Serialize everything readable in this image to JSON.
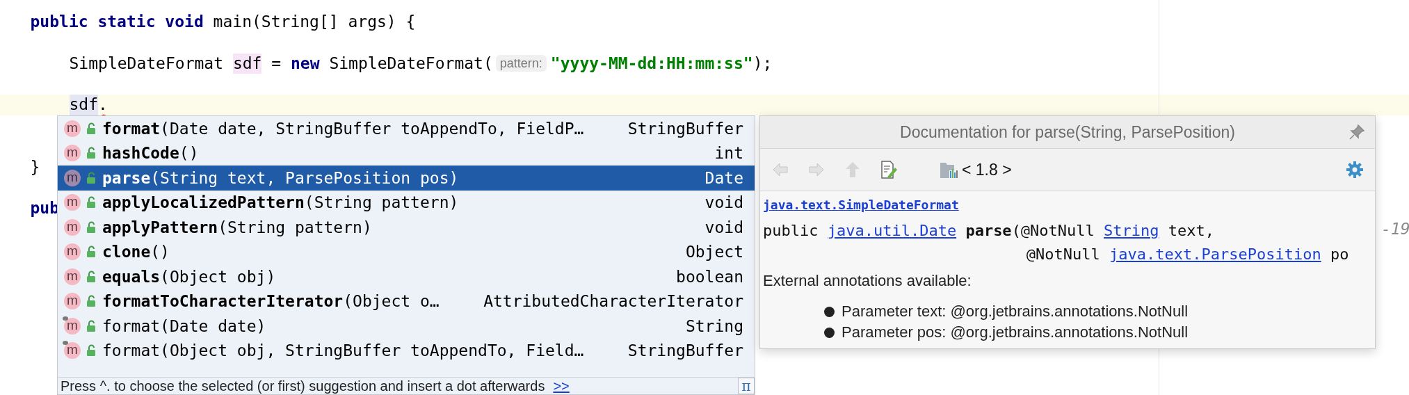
{
  "editor": {
    "lines": [
      {
        "current": false,
        "tokens": [
          {
            "kind": "keyword",
            "text": "public static void "
          },
          {
            "kind": "plain",
            "text": "main(String[] args) {"
          }
        ]
      },
      {
        "current": false
      },
      {
        "current": false,
        "indented": true,
        "tokens": [
          {
            "kind": "plain",
            "text": "SimpleDateFormat "
          },
          {
            "kind": "usage",
            "text": "sdf"
          },
          {
            "kind": "plain",
            "text": " = "
          },
          {
            "kind": "keyword",
            "text": "new"
          },
          {
            "kind": "plain",
            "text": " SimpleDateFormat("
          },
          {
            "kind": "hint",
            "text": "pattern:"
          },
          {
            "kind": "string",
            "text": "\"yyyy-MM-dd:HH:mm:ss\""
          },
          {
            "kind": "plain",
            "text": ");"
          }
        ]
      },
      {
        "current": false
      },
      {
        "current": true,
        "indented": true,
        "tokens": [
          {
            "kind": "read",
            "text": "sdf"
          },
          {
            "kind": "error",
            "text": "."
          }
        ]
      },
      {
        "current": false
      },
      {
        "current": false
      },
      {
        "current": false,
        "tokens": [
          {
            "kind": "plain",
            "text": "}"
          }
        ]
      },
      {
        "current": false
      },
      {
        "current": false,
        "tokens": [
          {
            "kind": "keyword",
            "text": "pub"
          }
        ]
      },
      {
        "current": false,
        "tokens": [
          {
            "kind": "fragment",
            "text": "-19"
          }
        ]
      }
    ]
  },
  "completion": {
    "items": [
      {
        "icon": "m",
        "name": "format",
        "params": "(Date date, StringBuffer toAppendTo, FieldP…",
        "type": "StringBuffer",
        "selected": false,
        "inherited": false
      },
      {
        "icon": "m",
        "name": "hashCode",
        "params": "()",
        "type": "int",
        "selected": false,
        "inherited": false
      },
      {
        "icon": "m",
        "name": "parse",
        "params": "(String text, ParsePosition pos)",
        "type": "Date",
        "selected": true,
        "inherited": false
      },
      {
        "icon": "m",
        "name": "applyLocalizedPattern",
        "params": "(String pattern)",
        "type": "void",
        "selected": false,
        "inherited": false
      },
      {
        "icon": "m",
        "name": "applyPattern",
        "params": "(String pattern)",
        "type": "void",
        "selected": false,
        "inherited": false
      },
      {
        "icon": "m",
        "name": "clone",
        "params": "()",
        "type": "Object",
        "selected": false,
        "inherited": false
      },
      {
        "icon": "m",
        "name": "equals",
        "params": "(Object obj)",
        "type": "boolean",
        "selected": false,
        "inherited": false
      },
      {
        "icon": "m",
        "name": "formatToCharacterIterator",
        "params": "(Object o…",
        "type": "AttributedCharacterIterator",
        "selected": false,
        "inherited": false
      },
      {
        "icon": "m",
        "name": "format",
        "params": "(Date date)",
        "type": "String",
        "selected": false,
        "inherited": true
      },
      {
        "icon": "m",
        "name": "format",
        "params": "(Object obj, StringBuffer toAppendTo, Field…",
        "type": "StringBuffer",
        "selected": false,
        "inherited": true
      }
    ],
    "footer": {
      "hint": "Press ^. to choose the selected (or first) suggestion and insert a dot afterwards",
      "link": ">>",
      "pi": "π"
    }
  },
  "documentation": {
    "title": "Documentation for parse(String, ParsePosition)",
    "version": "< 1.8 >",
    "class_link": "java.text.SimpleDateFormat",
    "signature": [
      [
        {
          "kind": "plain",
          "text": "public "
        },
        {
          "kind": "link",
          "text": "java.util.Date"
        },
        {
          "kind": "bold",
          "text": "parse"
        },
        {
          "kind": "plain",
          "text": "(@NotNull "
        },
        {
          "kind": "link",
          "text": "String"
        },
        {
          "kind": "plain",
          "text": " text,"
        }
      ],
      [
        {
          "kind": "plain",
          "text": "@NotNull "
        },
        {
          "kind": "link",
          "text": "java.text.ParsePosition"
        },
        {
          "kind": "plain",
          "text": " po"
        }
      ]
    ],
    "annotations_heading": "External annotations available:",
    "annotations": [
      "Parameter text: @org.jetbrains.annotations.NotNull",
      "Parameter pos: @org.jetbrains.annotations.NotNull"
    ]
  }
}
